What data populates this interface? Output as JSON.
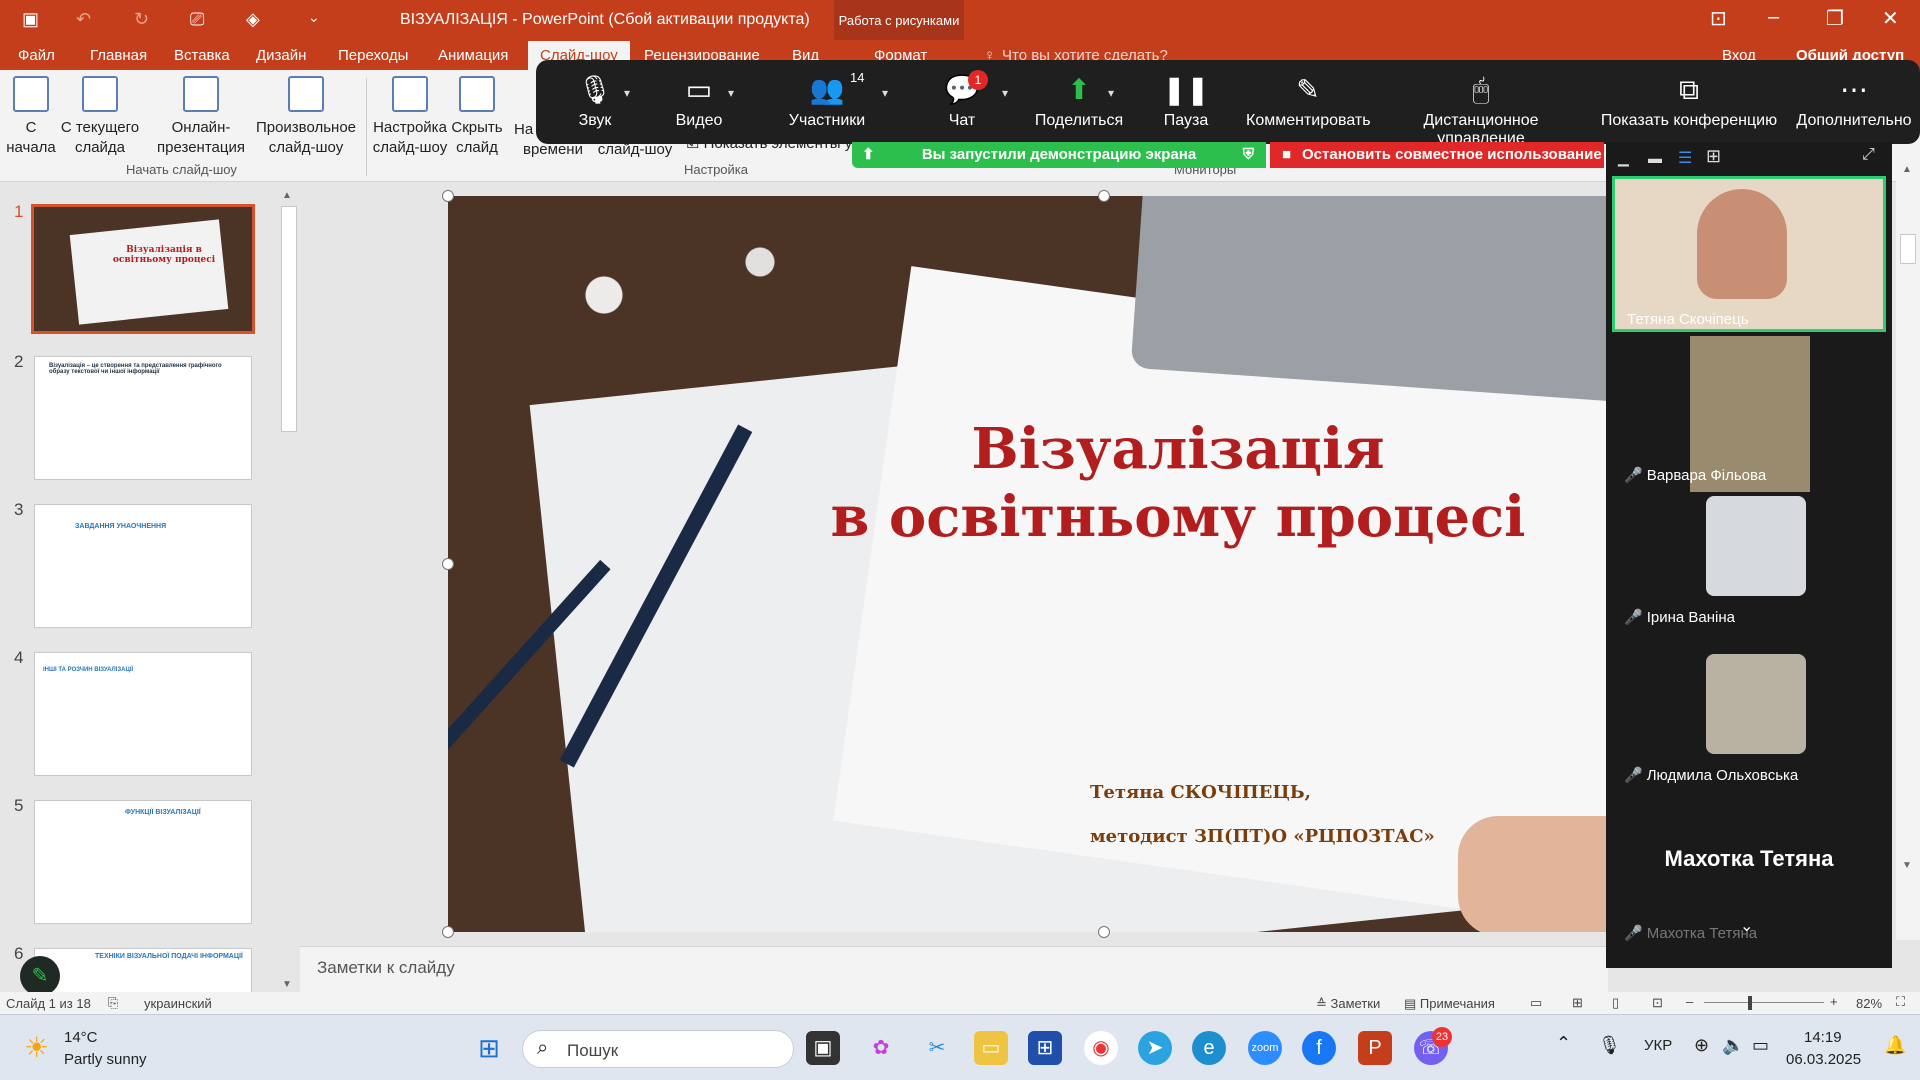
{
  "window": {
    "title": "ВІЗУАЛІЗАЦІЯ - PowerPoint (Сбой активации продукта)",
    "context_tab_group": "Работа с рисунками"
  },
  "ribbon_tabs": [
    "Файл",
    "Главная",
    "Вставка",
    "Дизайн",
    "Переходы",
    "Анимация",
    "Слайд-шоу",
    "Рецензирование",
    "Вид",
    "Формат"
  ],
  "ribbon_search": "Что вы хотите сделать?",
  "account": {
    "signin": "Вход",
    "share": "Общий доступ"
  },
  "ribbon": {
    "from_start": "С начала",
    "from_current": "С текущего слайда",
    "online": "Онлайн-презентация",
    "custom": "Произвольное слайд-шоу",
    "group_start": "Начать слайд-шоу",
    "setup": "Настройка слайд-шоу",
    "hide": "Скрыть слайд",
    "rehearse": "времени",
    "rehearse_prefix": "На",
    "record": "слайд-шоу",
    "show_elements": "Показать элементы у",
    "group_setup": "Настройка",
    "group_monitors": "Мониторы"
  },
  "zoom_toolbar": {
    "audio": "Звук",
    "video": "Видео",
    "participants": "Участники",
    "participants_count": "14",
    "chat": "Чат",
    "chat_badge": "1",
    "share": "Поделиться",
    "pause": "Пауза",
    "annotate": "Комментировать",
    "remote": "Дистанционное управление",
    "view": "Показать конференцию",
    "more": "Дополнительно",
    "sharing_banner": "Вы запустили демонстрацию экрана",
    "stop_share": "Остановить совместное использование"
  },
  "thumbnails": [
    {
      "num": "1",
      "title": "Візуалізація в освітньому процесі"
    },
    {
      "num": "2",
      "title": "Візуалізація – це створення та представлення графічного образу текстової чи іншої інформації"
    },
    {
      "num": "3",
      "title": "ЗАВДАННЯ УНАОЧНЕННЯ"
    },
    {
      "num": "4",
      "title": "ІНШІ ТА РОЗЧИН ВІЗУАЛІЗАЦІЇ"
    },
    {
      "num": "5",
      "title": "ФУНКЦІЇ ВІЗУАЛІЗАЦІЇ"
    },
    {
      "num": "6",
      "title": "ТЕХНІКИ ВІЗУАЛЬНОЇ ПОДАЧІ ІНФОРМАЦІЇ"
    }
  ],
  "slide": {
    "title_line1": "Візуалізація",
    "title_line2": "в освітньому процесі",
    "author_line1": "Тетяна СКОЧІПЕЦЬ,",
    "author_line2": "методист ЗП(ПТ)О «РЦПОЗТАС»"
  },
  "notes_placeholder": "Заметки к слайду",
  "participants": [
    {
      "name": "Тетяна Скочіпець",
      "muted": false
    },
    {
      "name": "Варвара Фільова",
      "muted": true
    },
    {
      "name": "Ірина Ваніна",
      "muted": true
    },
    {
      "name": "Людмила Ольховська",
      "muted": true
    },
    {
      "name": "Махотка Тетяна",
      "muted": true
    }
  ],
  "status": {
    "slide_of": "Слайд 1 из 18",
    "language": "украинский",
    "notes": "Заметки",
    "comments": "Примечания",
    "zoom": "82%"
  },
  "taskbar": {
    "weather_temp": "14°C",
    "weather_desc": "Partly sunny",
    "search": "Пошук",
    "lang": "УКР",
    "time": "14:19",
    "date": "06.03.2025",
    "viber_badge": "23"
  },
  "colors": {
    "accent": "#c43e1c",
    "zoom_bar": "#1f1f1f",
    "share_green": "#2dbf4e",
    "stop_red": "#e02828",
    "title_red": "#b21d1d"
  }
}
